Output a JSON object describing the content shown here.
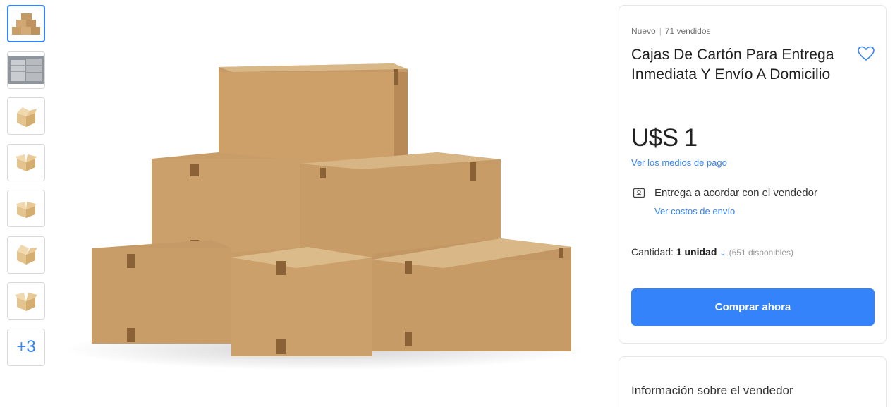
{
  "thumbnails": [
    {
      "icon": "boxes-pyramid-icon",
      "active": true
    },
    {
      "icon": "warehouse-stack-icon",
      "active": false
    },
    {
      "icon": "open-box-icon",
      "active": false
    },
    {
      "icon": "open-box-icon",
      "active": false
    },
    {
      "icon": "open-box-icon",
      "active": false
    },
    {
      "icon": "open-box-icon",
      "active": false
    },
    {
      "icon": "open-box-icon",
      "active": false
    }
  ],
  "more_thumbs_label": "+3",
  "product": {
    "condition": "Nuevo",
    "sold": "71 vendidos",
    "title": "Cajas De Cartón Para Entrega Inmediata Y Envío A Domicilio",
    "currency": "U$S",
    "price": "1",
    "payment_link": "Ver los medios de pago",
    "shipping_text": "Entrega a acordar con el vendedor",
    "shipping_link": "Ver costos de envío",
    "quantity_label": "Cantidad:",
    "quantity_value": "1 unidad",
    "available": "(651 disponibles)",
    "buy_button": "Comprar ahora"
  },
  "seller": {
    "title": "Información sobre el vendedor"
  },
  "colors": {
    "accent": "#3483fa",
    "cardboard": "#c9a474"
  }
}
